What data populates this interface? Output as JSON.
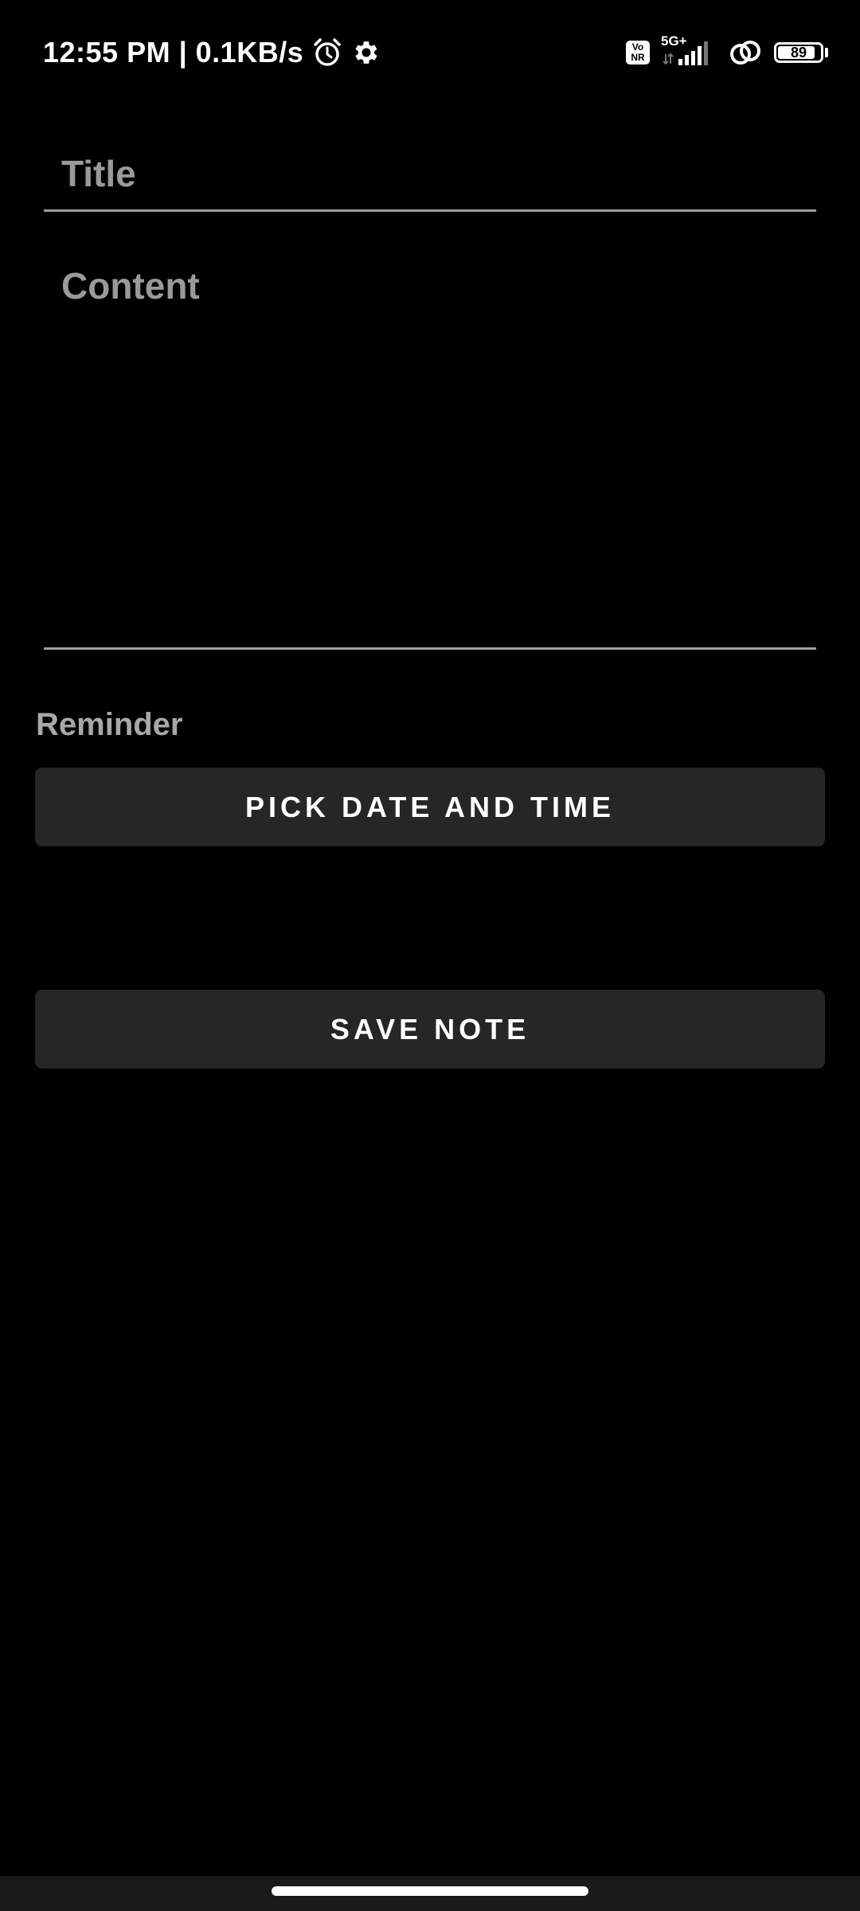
{
  "status_bar": {
    "time_speed": "12:55 PM | 0.1KB/s",
    "volte_badge": [
      "Vo",
      "NR"
    ],
    "network_type": "5G+",
    "battery_level": "89",
    "icons": [
      "alarm-icon",
      "gear-icon",
      "volte-icon",
      "signal-icon",
      "link-icon",
      "battery-icon"
    ]
  },
  "form": {
    "title_placeholder": "Title",
    "content_placeholder": "Content",
    "reminder_label": "Reminder",
    "pick_button_label": "PICK DATE AND TIME",
    "save_button_label": "SAVE NOTE"
  },
  "colors": {
    "background": "#000000",
    "button": "#262626",
    "placeholder": "#9a9a9a",
    "underline": "#9e9e9e"
  }
}
